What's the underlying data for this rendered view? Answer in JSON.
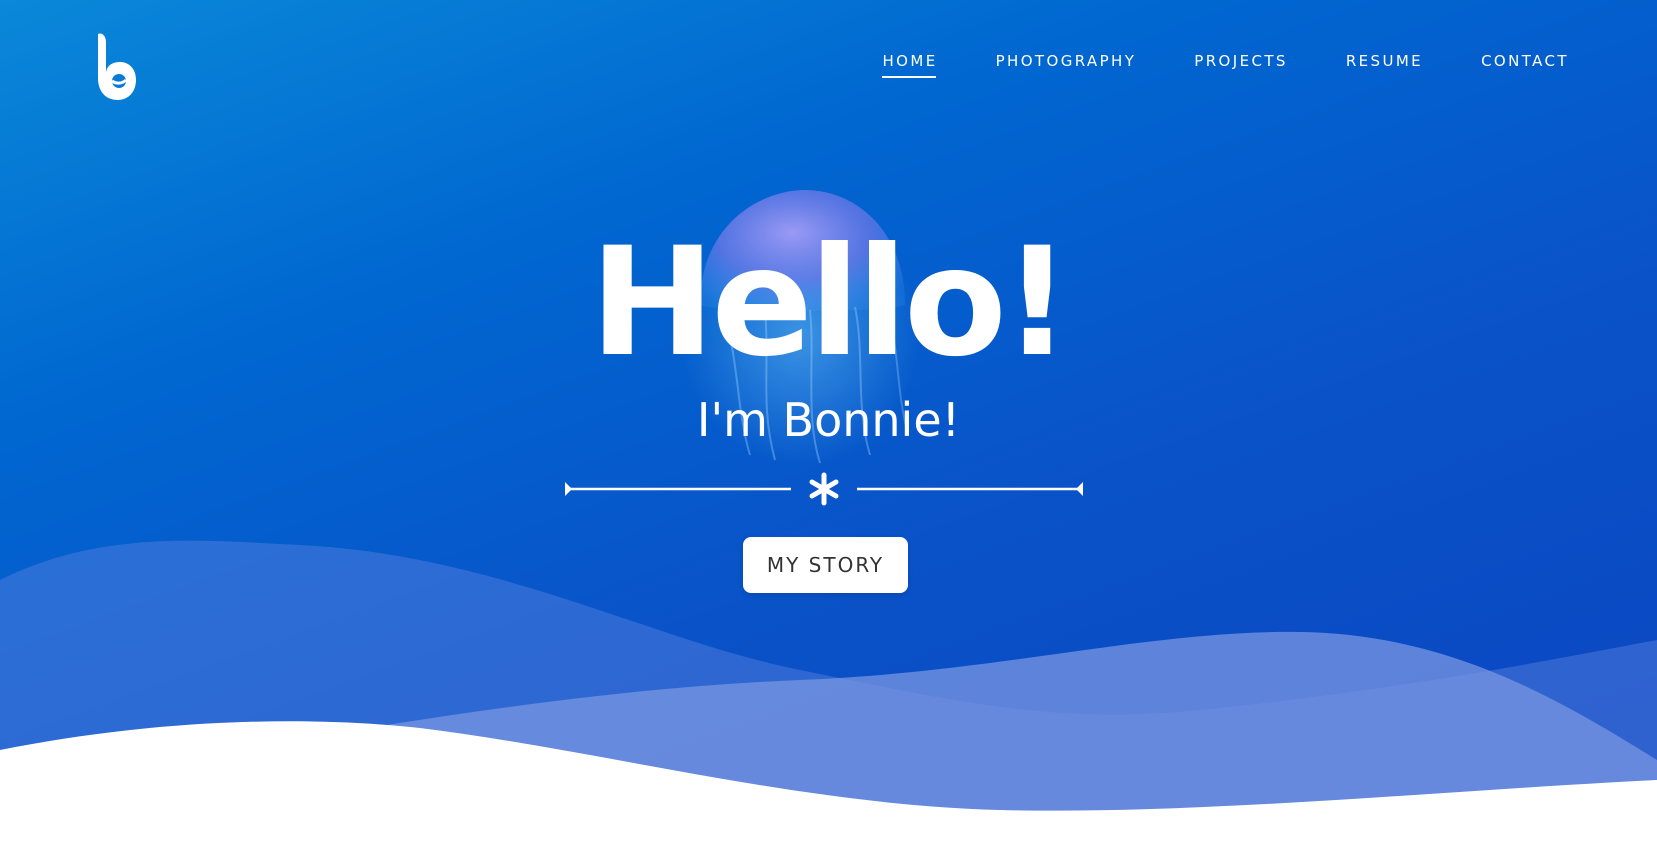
{
  "nav": {
    "logo_icon": "b-logo-icon",
    "items": [
      {
        "label": "HOME",
        "active": true
      },
      {
        "label": "PHOTOGRAPHY",
        "active": false
      },
      {
        "label": "PROJECTS",
        "active": false
      },
      {
        "label": "RESUME",
        "active": false
      },
      {
        "label": "CONTACT",
        "active": false
      }
    ]
  },
  "hero": {
    "headline": "Hello!",
    "subheadline": "I'm Bonnie!",
    "divider_icon": "asterisk-icon",
    "cta_label": "MY STORY",
    "background_image": "jellyfish-icon"
  },
  "colors": {
    "hero_gradient_top": "#0a88d9",
    "hero_gradient_bottom": "#0b44c0",
    "wave_light": "#6f8fe0",
    "text": "#ffffff",
    "button_text": "#333333"
  }
}
